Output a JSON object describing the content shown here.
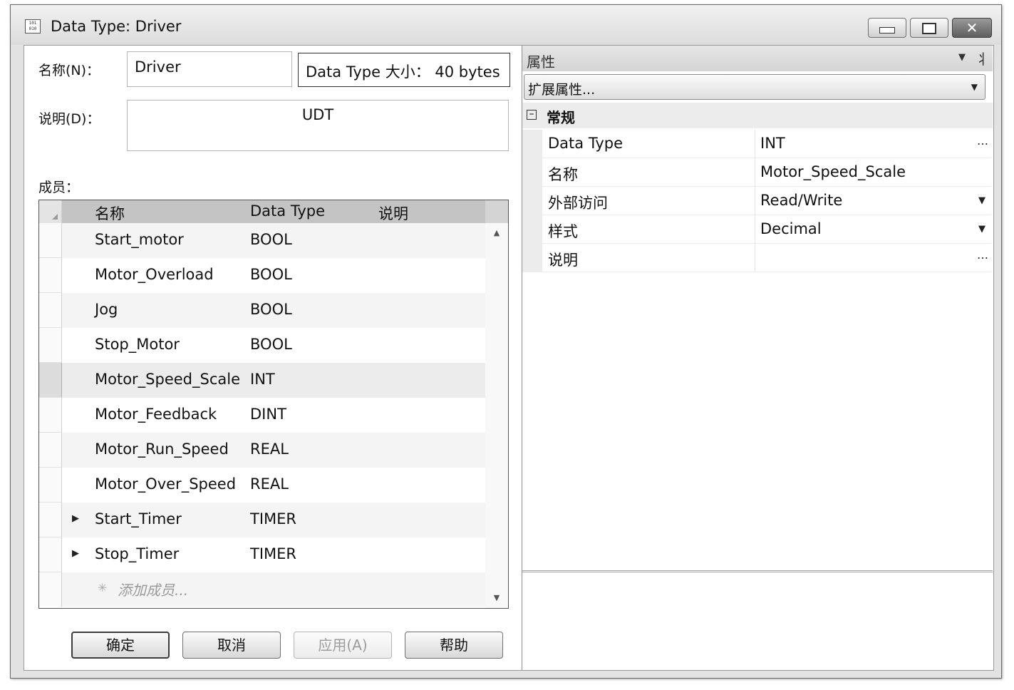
{
  "window": {
    "title": "Data Type:  Driver",
    "icon_label": "101\n010",
    "controls": {
      "minimize": "minimize",
      "maximize": "maximize",
      "close": "✕"
    }
  },
  "form": {
    "name_label": "名称(N)：",
    "name_value": "Driver",
    "size_text": "Data Type 大小： 40 bytes",
    "desc_label": "说明(D)：",
    "desc_value": "UDT",
    "members_label": "成员："
  },
  "grid": {
    "headers": {
      "name": "名称",
      "type": "Data Type",
      "desc": "说明"
    },
    "rows": [
      {
        "name": "Start_motor",
        "type": "BOOL",
        "expandable": false
      },
      {
        "name": "Motor_Overload",
        "type": "BOOL",
        "expandable": false
      },
      {
        "name": "Jog",
        "type": "BOOL",
        "expandable": false
      },
      {
        "name": "Stop_Motor",
        "type": "BOOL",
        "expandable": false
      },
      {
        "name": "Motor_Speed_Scale",
        "type": "INT",
        "expandable": false,
        "selected": true
      },
      {
        "name": "Motor_Feedback",
        "type": "DINT",
        "expandable": false
      },
      {
        "name": "Motor_Run_Speed",
        "type": "REAL",
        "expandable": false
      },
      {
        "name": "Motor_Over_Speed",
        "type": "REAL",
        "expandable": false
      },
      {
        "name": "Start_Timer",
        "type": "TIMER",
        "expandable": true
      },
      {
        "name": "Stop_Timer",
        "type": "TIMER",
        "expandable": true
      }
    ],
    "add_member": "添加成员..."
  },
  "buttons": {
    "ok": "确定",
    "cancel": "取消",
    "apply": "应用(A)",
    "help": "帮助"
  },
  "properties": {
    "title": "属性",
    "combo_value": "扩展属性...",
    "category": "常规",
    "items": [
      {
        "name": "Data Type",
        "value": "INT",
        "control": "…"
      },
      {
        "name": "名称",
        "value": "Motor_Speed_Scale",
        "control": ""
      },
      {
        "name": "外部访问",
        "value": "Read/Write",
        "control": "▼"
      },
      {
        "name": "样式",
        "value": "Decimal",
        "control": "▼"
      },
      {
        "name": "说明",
        "value": "",
        "control": "…"
      }
    ]
  }
}
